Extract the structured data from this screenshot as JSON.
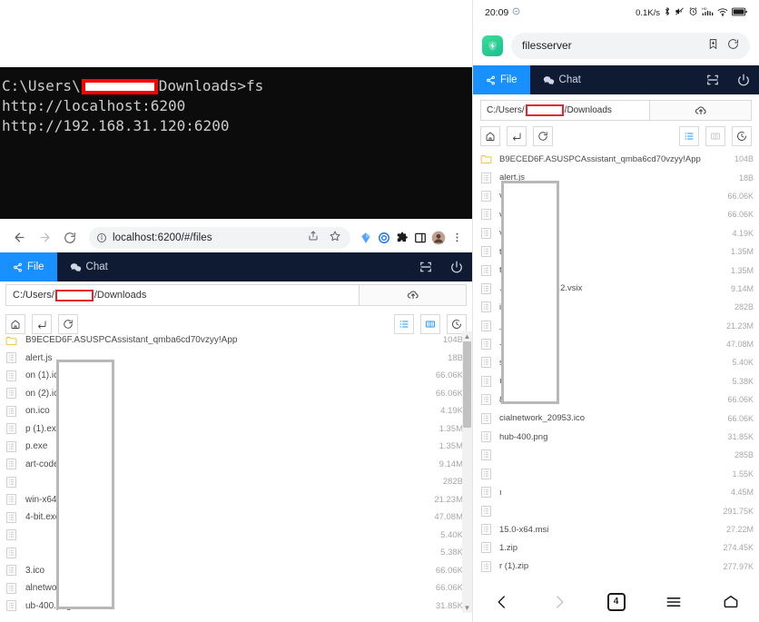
{
  "terminal": {
    "prompt_prefix": "C:\\Users\\",
    "prompt_suffix": "Downloads>fs",
    "lines": [
      "http://localhost:6200",
      "http://192.168.31.120:6200"
    ]
  },
  "browser": {
    "back_icon": "back-arrow-icon",
    "forward_icon": "forward-arrow-icon",
    "reload_icon": "reload-icon",
    "info_icon": "site-info-icon",
    "url": "localhost:6200/#/files",
    "share_icon": "share-icon",
    "star_icon": "bookmark-star-icon",
    "extensions": [
      "kite-extension-icon",
      "target-extension-icon",
      "puzzle-extension-icon",
      "sidepanel-icon",
      "profile-avatar-icon",
      "chrome-menu-icon"
    ]
  },
  "app": {
    "tabs": [
      {
        "label": "File",
        "icon": "share-nodes-icon",
        "active": true
      },
      {
        "label": "Chat",
        "icon": "wechat-icon",
        "active": false
      }
    ],
    "header_actions": [
      {
        "name": "scan-qr-icon"
      },
      {
        "name": "power-icon"
      }
    ],
    "path": {
      "prefix": "C:/Users/",
      "suffix": "/Downloads",
      "upload_icon": "cloud-upload-icon"
    },
    "toolbar": {
      "home_icon": "home-icon",
      "back_icon": "go-back-icon",
      "refresh_icon": "refresh-icon",
      "list_view_icon": "list-view-icon",
      "card_view_icon": "card-view-icon",
      "history_icon": "history-clock-icon"
    }
  },
  "desktop_files": [
    {
      "name": "B9ECED6F.ASUSPCAssistant_qmba6cd70vzyy!App",
      "size": "104B",
      "type": "folder"
    },
    {
      "name": "alert.js",
      "size": "18B",
      "type": "file"
    },
    {
      "name": "on (1).ico",
      "size": "66.06K",
      "type": "file"
    },
    {
      "name": "on (2).ico",
      "size": "66.06K",
      "type": "file"
    },
    {
      "name": "on.ico",
      "size": "4.19K",
      "type": "file"
    },
    {
      "name": "p (1).exe",
      "size": "1.35M",
      "type": "file"
    },
    {
      "name": "p.exe",
      "size": "1.35M",
      "type": "file"
    },
    {
      "name": "art-code-3.38.2.vsix",
      "size": "9.14M",
      "type": "file"
    },
    {
      "name": "",
      "size": "282B",
      "type": "file"
    },
    {
      "name": "win-x64.zip",
      "size": "21.23M",
      "type": "file"
    },
    {
      "name": "4-bit.exe",
      "size": "47.08M",
      "type": "file"
    },
    {
      "name": "",
      "size": "5.40K",
      "type": "file"
    },
    {
      "name": "",
      "size": "5.38K",
      "type": "file"
    },
    {
      "name": "3.ico",
      "size": "66.06K",
      "type": "file"
    },
    {
      "name": "alnetwork_20953.ico",
      "size": "66.06K",
      "type": "file"
    },
    {
      "name": "ub-400.png",
      "size": "31.85K",
      "type": "file"
    }
  ],
  "mobile": {
    "status": {
      "time": "20:09",
      "status_left_icon": "sync-status-icon",
      "net_speed": "0.1K/s",
      "icons": [
        "bluetooth-icon",
        "mute-icon",
        "alarm-icon",
        "hd-signal-icon",
        "wifi-icon",
        "battery-icon"
      ]
    },
    "address": {
      "shield_icon": "security-shield-icon",
      "url": "filesserver",
      "bookmark_icon": "add-bookmark-icon",
      "reload_icon": "reload-icon"
    },
    "nav": [
      {
        "name": "back-icon",
        "dim": false
      },
      {
        "name": "forward-icon",
        "dim": true
      },
      {
        "name": "tab-count",
        "label": "4",
        "dim": false
      },
      {
        "name": "menu-icon",
        "dim": false
      },
      {
        "name": "home-icon",
        "dim": false
      }
    ]
  },
  "mobile_files": [
    {
      "name": "B9ECED6F.ASUSPCAssistant_qmba6cd70vzyy!App",
      "size": "104B",
      "type": "folder"
    },
    {
      "name": "alert.js",
      "size": "18B",
      "type": "file"
    },
    {
      "name": "vicon (1).ico",
      "size": "66.06K",
      "type": "file"
    },
    {
      "name": "vicon (2).ico",
      "size": "66.06K",
      "type": "file"
    },
    {
      "name": "vicon.ico",
      "size": "4.19K",
      "type": "file"
    },
    {
      "name": "tup (1).exe",
      "size": "1.35M",
      "type": "file"
    },
    {
      "name": "tup.exe",
      "size": "1.35M",
      "type": "file"
    },
    {
      "name": ".dart-code-3.38.2.vsix",
      "size": "9.14M",
      "type": "file"
    },
    {
      "name": "i",
      "size": "282B",
      "type": "file"
    },
    {
      "name": "_win-x64.zip",
      "size": "21.23M",
      "type": "file"
    },
    {
      "name": "-64-bit.exe",
      "size": "47.08M",
      "type": "file"
    },
    {
      "name": "s",
      "size": "5.40K",
      "type": "file"
    },
    {
      "name": "ıg",
      "size": "5.38K",
      "type": "file"
    },
    {
      "name": "813.ico",
      "size": "66.06K",
      "type": "file"
    },
    {
      "name": "cialnetwork_20953.ico",
      "size": "66.06K",
      "type": "file"
    },
    {
      "name": "hub-400.png",
      "size": "31.85K",
      "type": "file"
    },
    {
      "name": "",
      "size": "285B",
      "type": "file"
    },
    {
      "name": "",
      "size": "1.55K",
      "type": "file"
    },
    {
      "name": "ı",
      "size": "4.45M",
      "type": "file"
    },
    {
      "name": "",
      "size": "291.75K",
      "type": "file"
    },
    {
      "name": "15.0-x64.msi",
      "size": "27.22M",
      "type": "file"
    },
    {
      "name": "1.zip",
      "size": "274.45K",
      "type": "file"
    },
    {
      "name": "r (1).zip",
      "size": "277.97K",
      "type": "file"
    }
  ],
  "colors": {
    "accent_blue": "#1890ff",
    "header_dark": "#0f1b33",
    "redact_red": "#e8232a",
    "terminal_bg": "#0c0c0c"
  }
}
